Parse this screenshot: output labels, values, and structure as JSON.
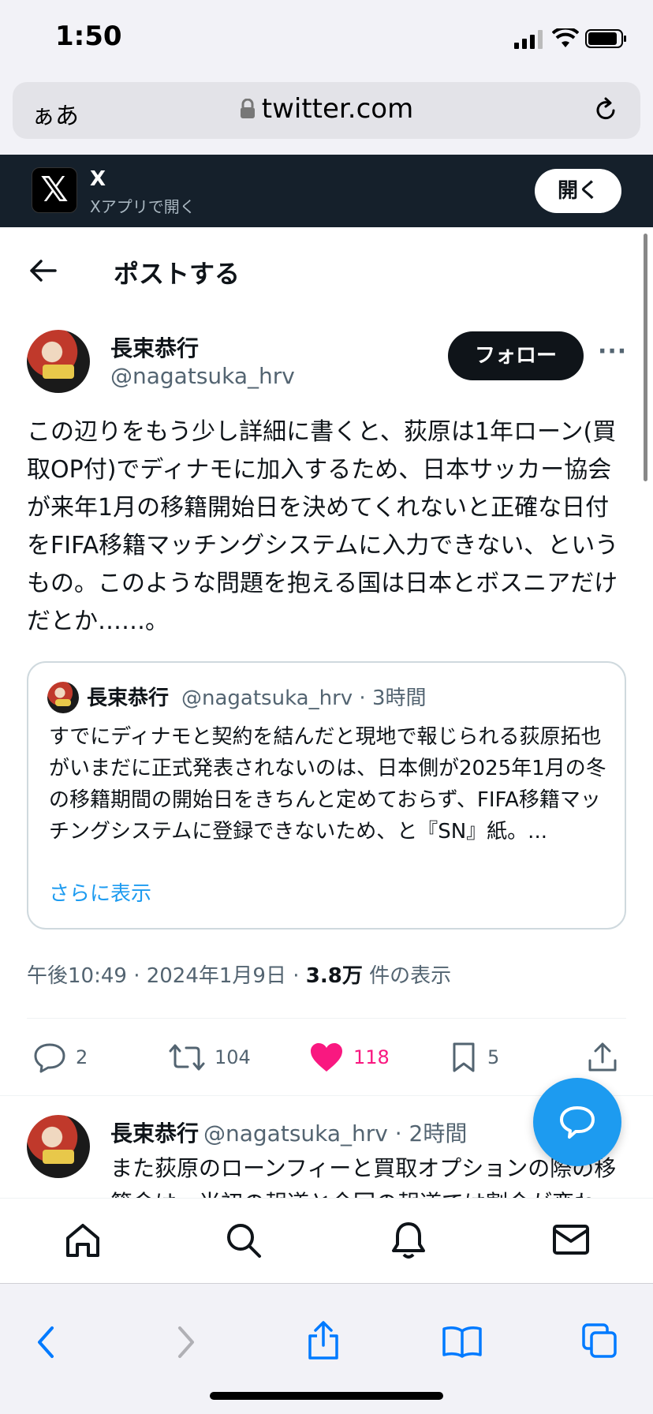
{
  "status": {
    "time": "1:50"
  },
  "browser": {
    "text_size": "ぁあ",
    "url": "twitter.com"
  },
  "banner": {
    "title": "X",
    "subtitle": "Xアプリで開く",
    "open_label": "開く",
    "logo": "𝕏"
  },
  "header": {
    "title": "ポストする"
  },
  "tweet": {
    "author_name": "長束恭行",
    "author_handle": "@nagatsuka_hrv",
    "follow_label": "フォロー",
    "more": "···",
    "text": "この辺りをもう少し詳細に書くと、荻原は1年ローン(買取OP付)でディナモに加入するため、日本サッカー協会が来年1月の移籍開始日を決めてくれないと正確な日付をFIFA移籍マッチングシステムに入力できない、というもの。このような問題を抱える国は日本とボスニアだけだとか……。",
    "quote": {
      "name": "長束恭行",
      "meta": "@nagatsuka_hrv · 3時間",
      "text": "すでにディナモと契約を結んだと現地で報じられる荻原拓也がいまだに正式発表されないのは、日本側が2025年1月の冬の移籍期間の開始日をきちんと定めておらず、FIFA移籍マッチングシステムに登録できないため、と『SN』紙。...",
      "show_more": "さらに表示"
    },
    "timestamp": "午後10:49 · 2024年1月9日 · ",
    "views": "3.8万",
    "views_label": " 件の表示",
    "replies": "2",
    "reposts": "104",
    "likes": "118",
    "bookmarks": "5",
    "like_color": "#f91880"
  },
  "reply": {
    "name": "長束恭行",
    "meta": "@nagatsuka_hrv · 2時間",
    "text": "また荻原のローンフィーと買取オプションの際の移籍金は、当初の報道と今回の報道では割合が変わっ"
  }
}
